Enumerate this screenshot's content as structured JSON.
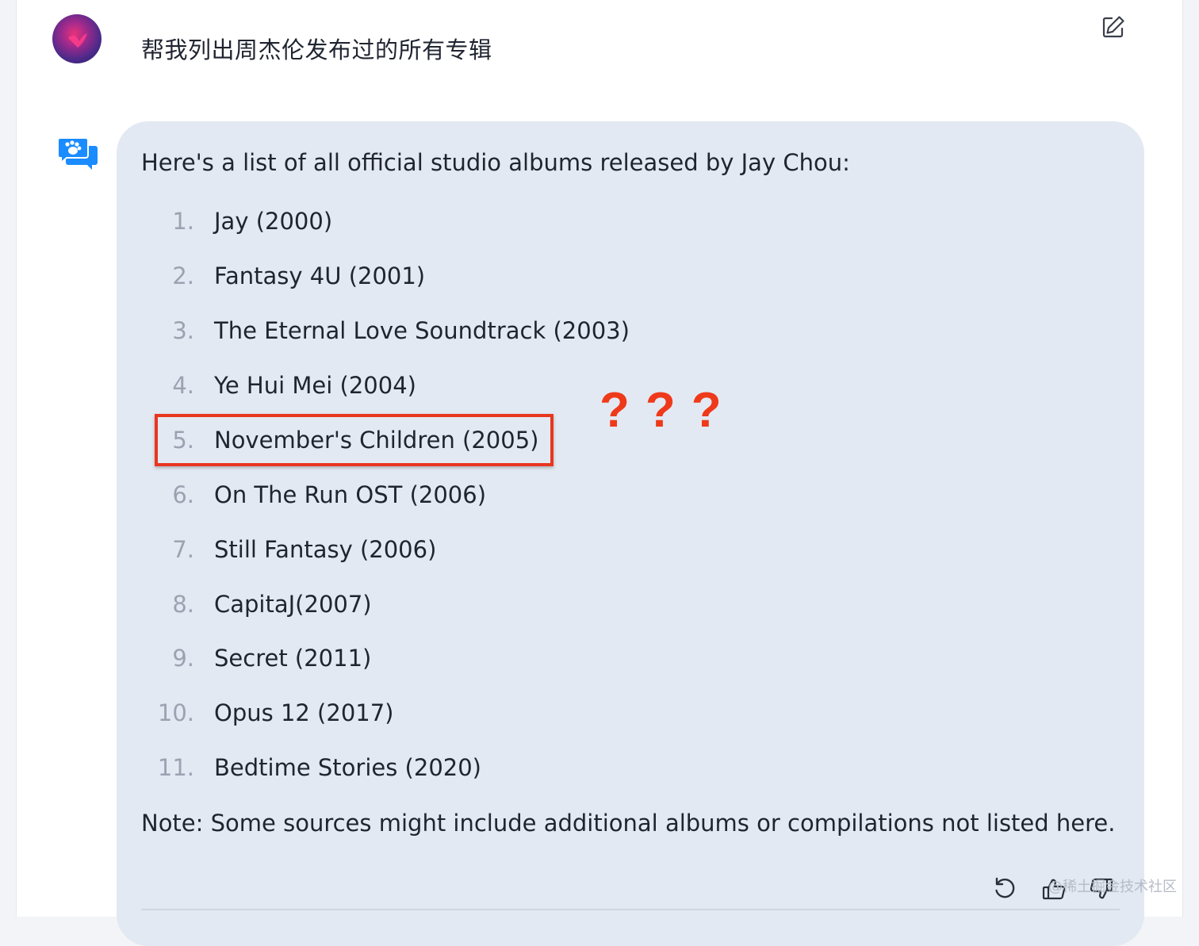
{
  "user": {
    "message": "帮我列出周杰伦发布过的所有专辑"
  },
  "icons": {
    "edit": "edit-icon",
    "bot": "chat-bubbles-icon",
    "regenerate": "refresh-icon",
    "like": "thumbs-up-icon",
    "dislike": "thumbs-down-icon"
  },
  "response": {
    "intro": "Here's a list of all official studio albums released by Jay Chou:",
    "albums": [
      {
        "num": "1.",
        "title": "Jay (2000)"
      },
      {
        "num": "2.",
        "title": "Fantasy 4U (2001)"
      },
      {
        "num": "3.",
        "title": "The Eternal Love Soundtrack (2003)"
      },
      {
        "num": "4.",
        "title": "Ye Hui Mei (2004)"
      },
      {
        "num": "5.",
        "title": "November's Children (2005)"
      },
      {
        "num": "6.",
        "title": "On The Run OST (2006)"
      },
      {
        "num": "7.",
        "title": "Still Fantasy (2006)"
      },
      {
        "num": "8.",
        "title": "CapitaJ(2007)"
      },
      {
        "num": "9.",
        "title": "Secret (2011)"
      },
      {
        "num": "10.",
        "title": "Opus 12 (2017)"
      },
      {
        "num": "11.",
        "title": "Bedtime Stories (2020)"
      }
    ],
    "note": "Note: Some sources might include additional albums or compilations not listed here."
  },
  "annotation": {
    "marks": "???",
    "color": "#ee3a1a"
  },
  "watermark": "@稀土掘金技术社区",
  "colors": {
    "bubble": "#e3e9f2",
    "highlight": "#e8361f",
    "bot_icon": "#1a8cff"
  }
}
